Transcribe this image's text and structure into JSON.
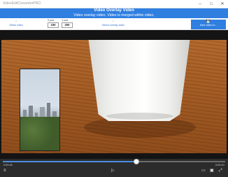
{
  "window": {
    "title": "VideoEditConverterPRO"
  },
  "banner": {
    "title": "Video Overlay Video",
    "subtitle": "Video overlay video, Video is merged within video."
  },
  "toolbar": {
    "select_video_label": "Select video",
    "x_pos_label": "X pos",
    "x_pos_value": "100",
    "y_pos_label": "Y pos",
    "y_pos_value": "200",
    "select_overlay_label": "Select overlay video",
    "save_label": "Save video to..."
  },
  "player": {
    "current_time": "0:00:05",
    "duration": "0:00:10",
    "progress": 0.6
  },
  "colors": {
    "accent": "#2f7fe0",
    "controls_bg": "#2b2b2b",
    "seek_fill": "#4a90e2"
  }
}
